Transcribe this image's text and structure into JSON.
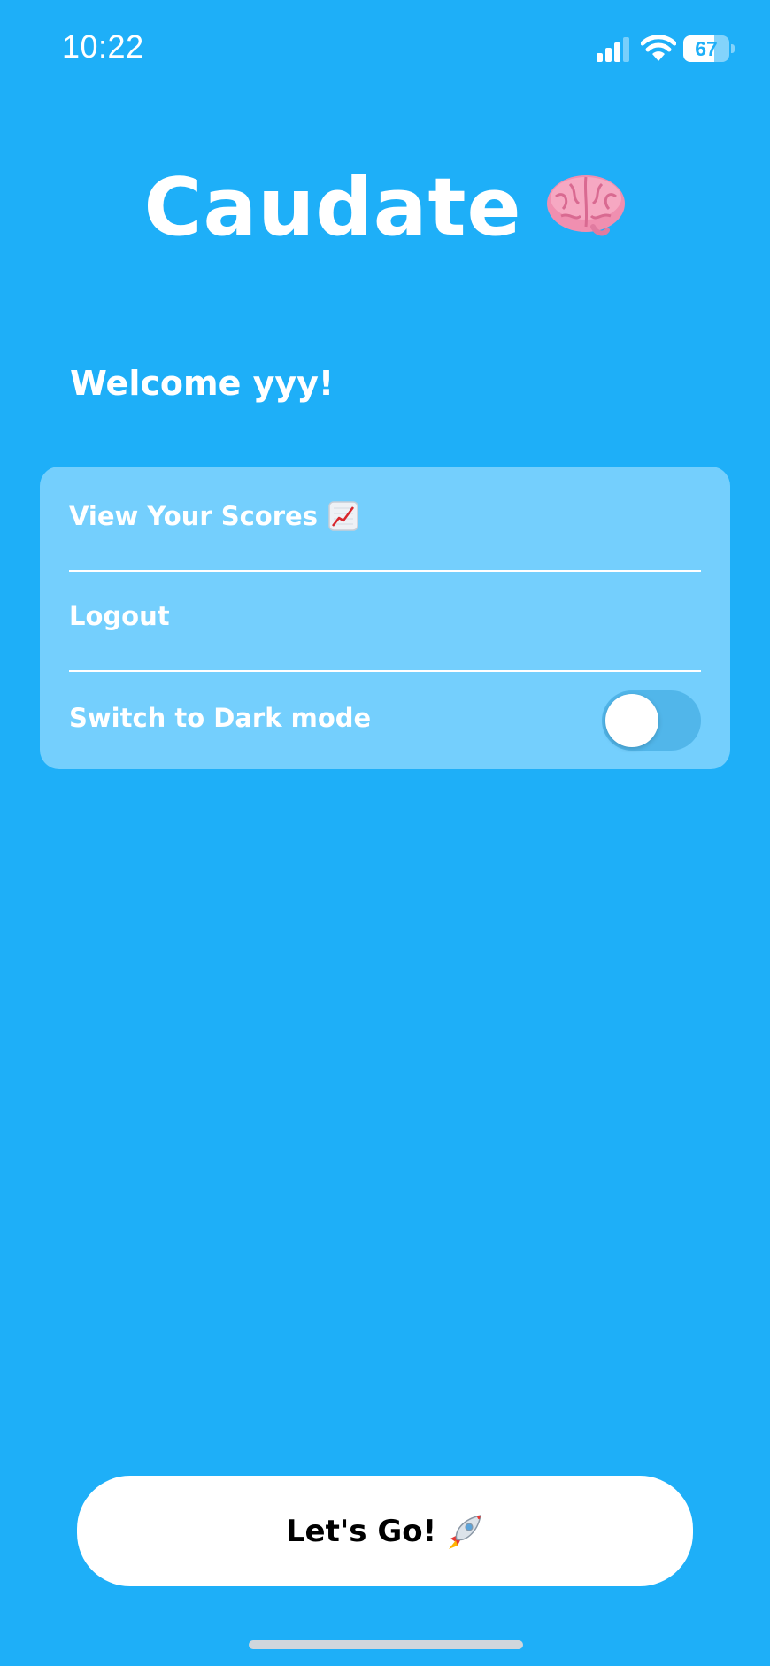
{
  "status_bar": {
    "time": "10:22",
    "battery_percent": "67",
    "battery_level": 0.67,
    "icons": [
      "signal-icon",
      "wifi-icon",
      "battery-icon"
    ]
  },
  "app": {
    "title": "Caudate",
    "title_icon": "brain-icon"
  },
  "welcome_text": "Welcome yyy!",
  "menu": {
    "items": [
      {
        "label": "View Your Scores",
        "icon": "chart-increasing-icon"
      },
      {
        "label": "Logout"
      },
      {
        "label": "Switch to Dark mode",
        "toggle_on": false
      }
    ]
  },
  "primary_button": {
    "label": "Let's Go!",
    "icon": "rocket-icon"
  },
  "colors": {
    "background": "#1EAFF8",
    "card": "#74CFFD",
    "text": "#FFFFFF",
    "button": "#FFFFFF",
    "button_text": "#000000"
  }
}
